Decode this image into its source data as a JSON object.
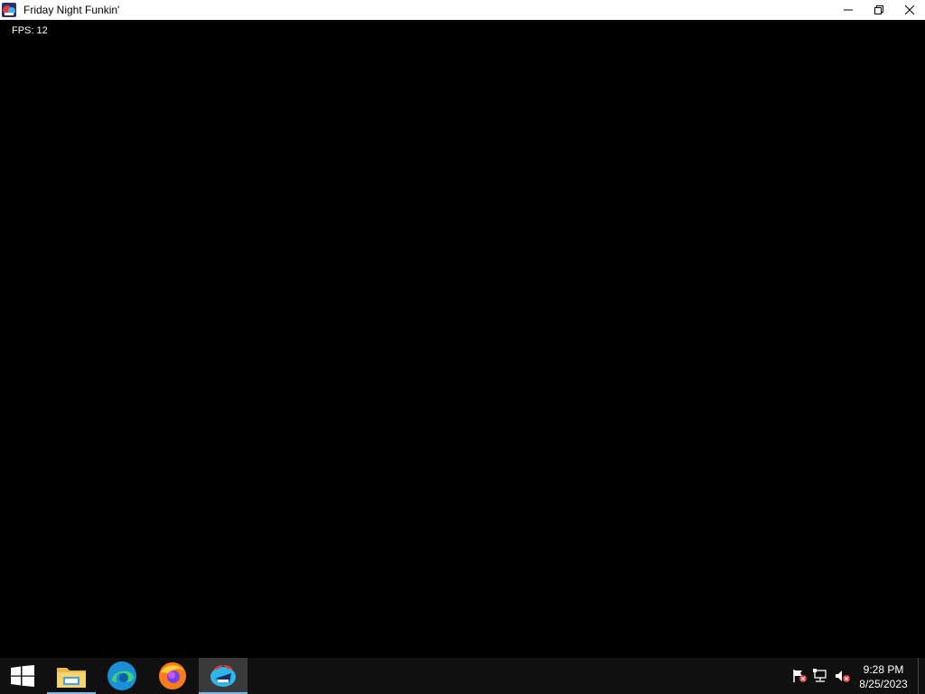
{
  "window": {
    "title": "Friday Night Funkin'",
    "icon": "fnf-app-icon",
    "controls": [
      "minimize-icon",
      "restore-icon",
      "close-icon"
    ]
  },
  "game": {
    "fps_label": "FPS: 12",
    "background": "#000000"
  },
  "taskbar": {
    "start_icon": "windows-logo-icon",
    "pinned": [
      {
        "name": "file-explorer",
        "icon": "folder-icon"
      },
      {
        "name": "microsoft-edge",
        "icon": "edge-icon"
      },
      {
        "name": "firefox",
        "icon": "firefox-icon"
      },
      {
        "name": "friday-night-funkin",
        "icon": "fnf-icon",
        "active": true
      }
    ],
    "tray": [
      "action-center-flag-icon",
      "network-icon",
      "volume-muted-icon"
    ],
    "clock": {
      "time": "9:28 PM",
      "date": "8/25/2023"
    },
    "accent": "#76b9ed"
  }
}
